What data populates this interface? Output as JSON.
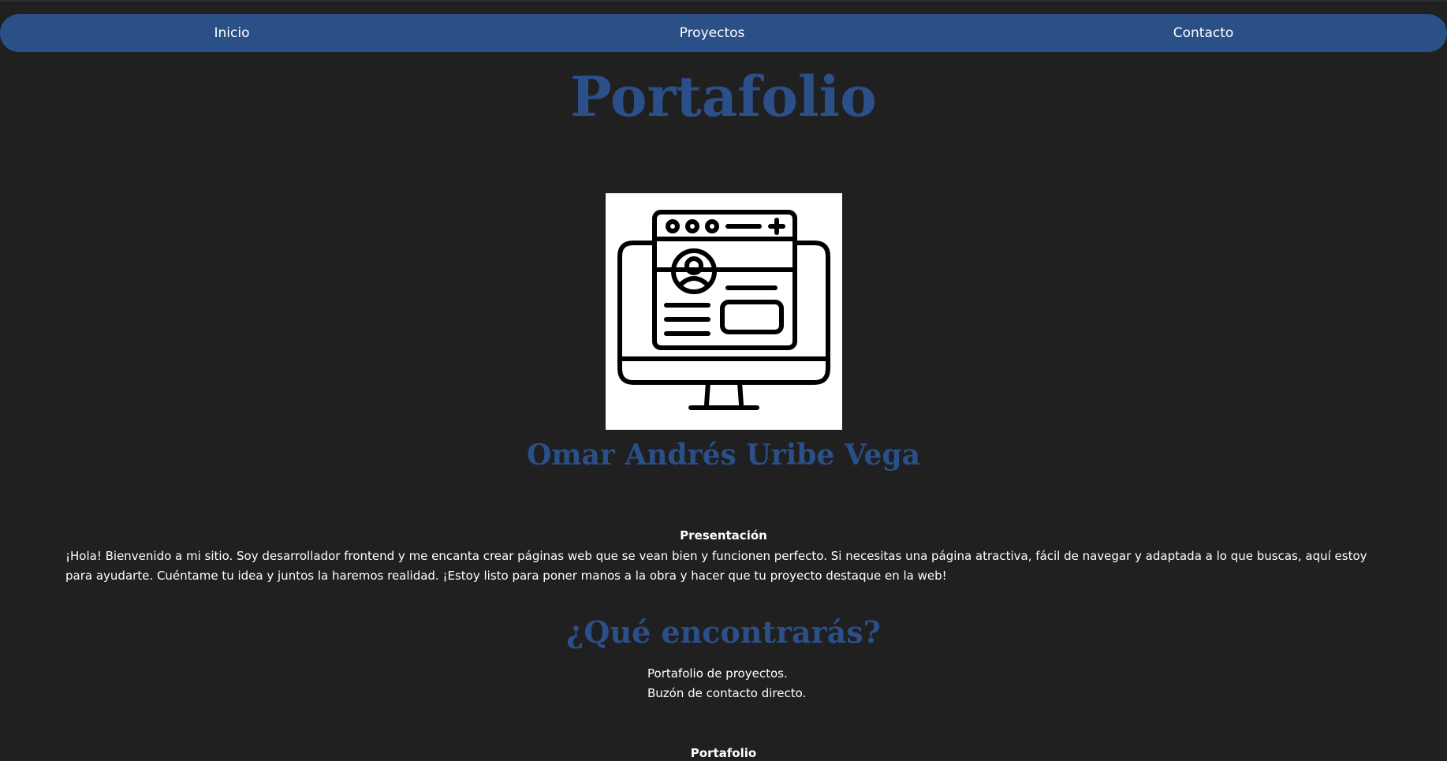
{
  "nav": {
    "items": [
      {
        "label": "Inicio"
      },
      {
        "label": "Proyectos"
      },
      {
        "label": "Contacto"
      }
    ]
  },
  "header": {
    "title": "Portafolio"
  },
  "profile": {
    "image_icon": "monitor-profile-icon",
    "name": "Omar Andrés Uribe Vega"
  },
  "presentation": {
    "label": "Presentación",
    "text": "¡Hola! Bienvenido a mi sitio. Soy desarrollador frontend y me encanta crear páginas web que se vean bien y funcionen perfecto. Si necesitas una página atractiva, fácil de navegar y adaptada a lo que buscas, aquí estoy para ayudarte. Cuéntame tu idea y juntos la haremos realidad. ¡Estoy listo para poner manos a la obra y hacer que tu proyecto destaque en la web!"
  },
  "features": {
    "title": "¿Qué encontrarás?",
    "items": [
      "Portafolio de proyectos.",
      "Buzón de contacto directo."
    ]
  },
  "portfolio": {
    "label": "Portafolio"
  },
  "colors": {
    "background": "#202020",
    "navbar": "#2b5088",
    "heading": "#2b4f88",
    "text": "#ffffff"
  }
}
